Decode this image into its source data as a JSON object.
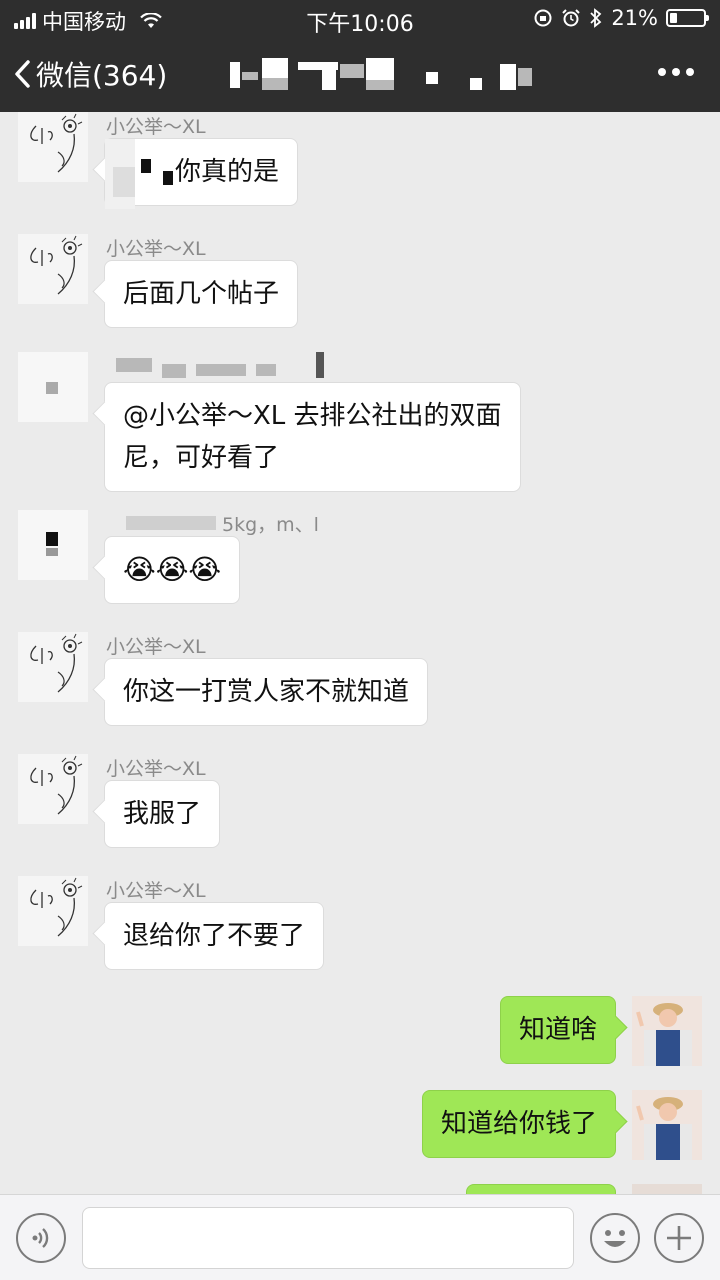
{
  "status_bar": {
    "carrier": "中国移动",
    "time": "下午10:06",
    "battery_percent": "21%",
    "battery_level": 0.21
  },
  "nav": {
    "back_label": "微信(364)",
    "title": ""
  },
  "messages": [
    {
      "side": "left",
      "sender": "小公举～XL",
      "text": "你真的是"
    },
    {
      "side": "left",
      "sender": "小公举～XL",
      "text": "后面几个帖子"
    },
    {
      "side": "left",
      "sender": "",
      "text_line1": "@小公举～XL 去排公社出的双面",
      "text_line2": "尼，可好看了"
    },
    {
      "side": "left",
      "sender": "5kg，m、l",
      "text": "😭😭😭"
    },
    {
      "side": "left",
      "sender": "小公举～XL",
      "text": "你这一打赏人家不就知道"
    },
    {
      "side": "left",
      "sender": "小公举～XL",
      "text": "我服了"
    },
    {
      "side": "left",
      "sender": "小公举～XL",
      "text": "退给你了不要了"
    },
    {
      "side": "right",
      "text": "知道啥"
    },
    {
      "side": "right",
      "text": "知道给你钱了"
    },
    {
      "side": "right",
      "text": ""
    }
  ],
  "icons": {
    "back": "chevron-left-icon",
    "more": "more-dots-icon",
    "voice": "voice-icon",
    "emoji": "emoji-icon",
    "plus": "plus-icon"
  },
  "colors": {
    "nav_bg": "#2e2e2e",
    "chat_bg": "#ebebeb",
    "bubble_in": "#ffffff",
    "bubble_out": "#9fe756"
  }
}
